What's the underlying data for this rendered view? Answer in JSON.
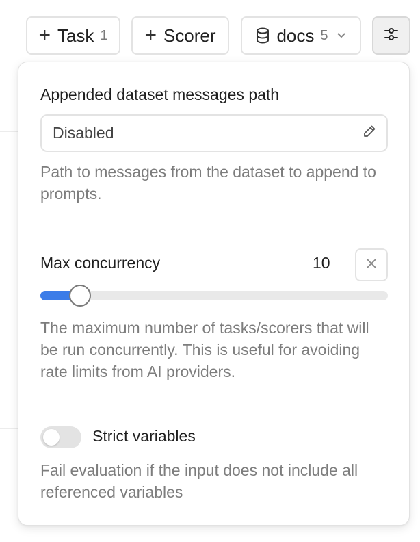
{
  "toolbar": {
    "task": {
      "label": "Task",
      "count": "1"
    },
    "scorer": {
      "label": "Scorer"
    },
    "docs": {
      "label": "docs",
      "count": "5"
    }
  },
  "settings_popover": {
    "messages_path": {
      "label": "Appended dataset messages path",
      "value": "Disabled",
      "help": "Path to messages from the dataset to append to prompts."
    },
    "max_concurrency": {
      "label": "Max concurrency",
      "value": "10",
      "slider_fraction": 0.115,
      "help": "The maximum number of tasks/scorers that will be run concurrently. This is useful for avoiding rate limits from AI providers."
    },
    "strict_variables": {
      "label": "Strict variables",
      "enabled": false,
      "help": "Fail evaluation if the input does not include all referenced variables"
    }
  },
  "colors": {
    "accent": "#3b7ce8",
    "muted_text": "#7d7d7d",
    "border": "#e3e3e3"
  },
  "icons": [
    "plus-icon",
    "database-icon",
    "chevron-down-icon",
    "sliders-icon",
    "pencil-icon",
    "close-icon"
  ]
}
